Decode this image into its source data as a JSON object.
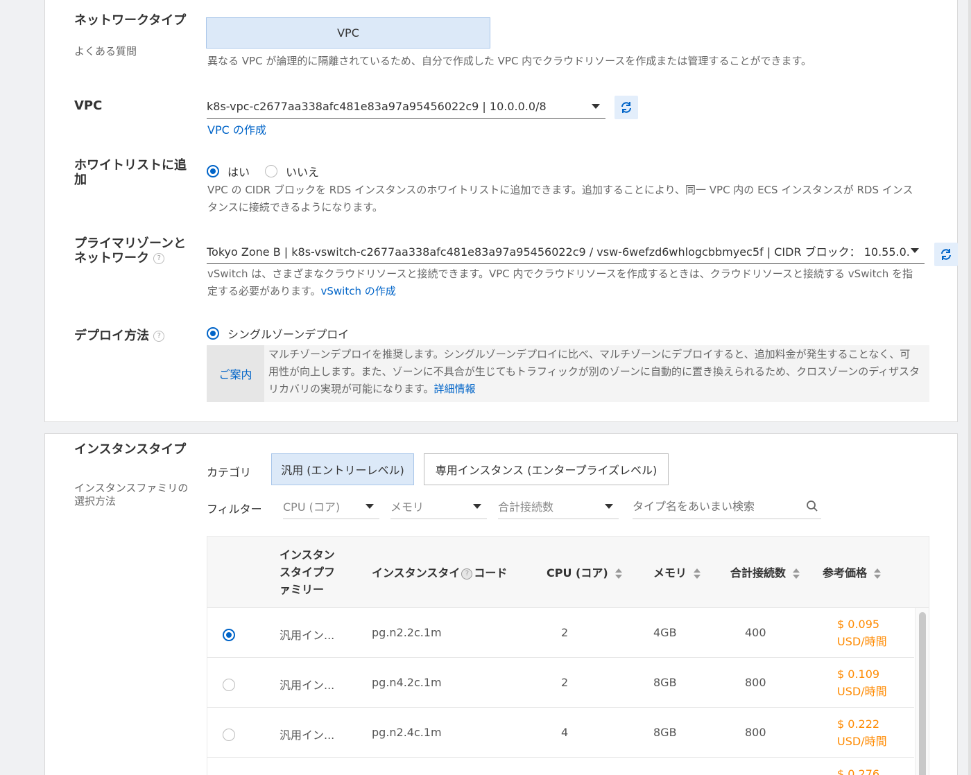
{
  "network": {
    "label": "ネットワークタイプ",
    "faq": "よくある質問",
    "button": "VPC",
    "desc": "異なる VPC が論理的に隔離されているため、自分で作成した VPC 内でクラウドリソースを作成または管理することができます。"
  },
  "vpc": {
    "label": "VPC",
    "value": "k8s-vpc-c2677aa338afc481e83a97a95456022c9 | 10.0.0.0/8",
    "create_link": "VPC の作成"
  },
  "whitelist": {
    "label": "ホワイトリストに追加",
    "yes": "はい",
    "no": "いいえ",
    "desc": "VPC の CIDR ブロックを RDS インスタンスのホワイトリストに追加できます。追加することにより、同一 VPC 内の ECS インスタンスが RDS インスタンスに接続できるようになります。"
  },
  "zone": {
    "label": "プライマリゾーンとネットワーク",
    "value": "Tokyo Zone B | k8s-vswitch-c2677aa338afc481e83a97a95456022c9 / vsw-6wefzd6whlogcbbmyec5f | CIDR ブロック： 10.55.0....",
    "desc": "vSwitch は、さまざまなクラウドリソースと接続できます。VPC 内でクラウドリソースを作成するときは、クラウドリソースと接続する vSwitch を指定する必要があります。",
    "create_link": "vSwitch の作成"
  },
  "deploy": {
    "label": "デプロイ方法",
    "option": "シングルゾーンデプロイ",
    "notice_tag": "ご案内",
    "notice": "マルチゾーンデプロイを推奨します。シングルゾーンデプロイに比べ、マルチゾーンにデプロイすると、追加料金が発生することなく、可用性が向上します。また、ゾーンに不具合が生じてもトラフィックが別のゾーンに自動的に置き換えられるため、クロスゾーンのディザスタリカバリの実現が可能になります。",
    "detail_link": "詳細情報"
  },
  "instance": {
    "label": "インスタンスタイプ",
    "sublabel": "インスタンスファミリの選択方法",
    "category_label": "カテゴリ",
    "tab_general": "汎用 (エントリーレベル)",
    "tab_dedicated": "専用インスタンス (エンタープライズレベル)",
    "filter_label": "フィルター",
    "filter_cpu": "CPU (コア)",
    "filter_mem": "メモリ",
    "filter_conn": "合計接続数",
    "search_placeholder": "タイプ名をあいまい検索"
  },
  "table": {
    "headers": {
      "family": "インスタンスタイプファミリー",
      "code": "インスタンスタイ",
      "code_suffix": "コード",
      "cpu": "CPU (コア)",
      "mem": "メモリ",
      "conn": "合計接続数",
      "price": "参考価格"
    },
    "rows": [
      {
        "family": "汎用イン...",
        "code": "pg.n2.2c.1m",
        "cpu": "2",
        "mem": "4GB",
        "conn": "400",
        "price": "$ 0.095",
        "unit": "USD/時間"
      },
      {
        "family": "汎用イン...",
        "code": "pg.n4.2c.1m",
        "cpu": "2",
        "mem": "8GB",
        "conn": "800",
        "price": "$ 0.109",
        "unit": "USD/時間"
      },
      {
        "family": "汎用イン...",
        "code": "pg.n2.4c.1m",
        "cpu": "4",
        "mem": "8GB",
        "conn": "800",
        "price": "$ 0.222",
        "unit": "USD/時間"
      },
      {
        "price": "$ 0.276"
      }
    ]
  }
}
